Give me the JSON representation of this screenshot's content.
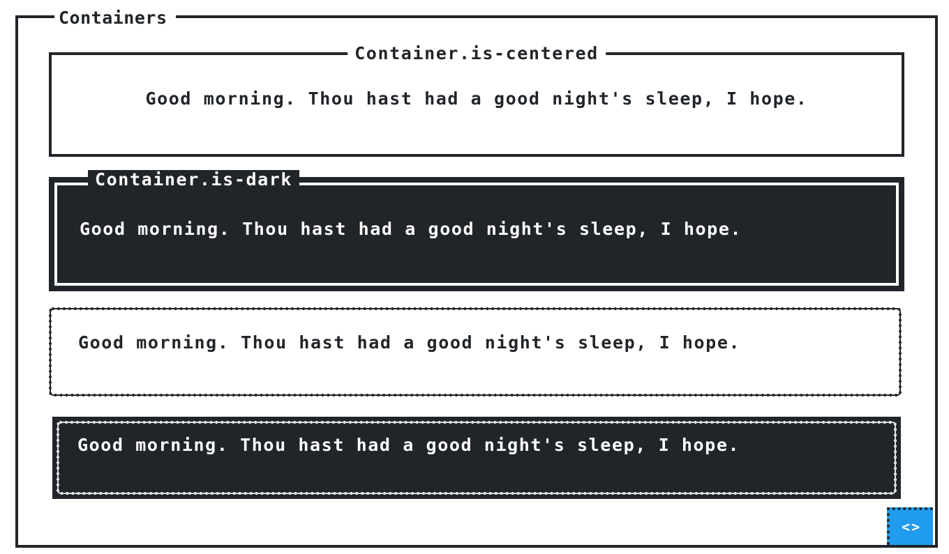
{
  "section": {
    "title": "Containers"
  },
  "containers": [
    {
      "title": "Container.is-centered",
      "text": "Good morning. Thou hast had a good night's sleep, I hope."
    },
    {
      "title": "Container.is-dark",
      "text": "Good morning. Thou hast had a good night's sleep, I hope."
    },
    {
      "text": "Good morning. Thou hast had a good night's sleep, I hope."
    },
    {
      "text": "Good morning. Thou hast had a good night's sleep, I hope."
    }
  ],
  "code_toggle": {
    "label": "<>",
    "icon": "code-icon",
    "color": "#209cee"
  },
  "colors": {
    "dark": "#212529",
    "light": "#ffffff"
  }
}
